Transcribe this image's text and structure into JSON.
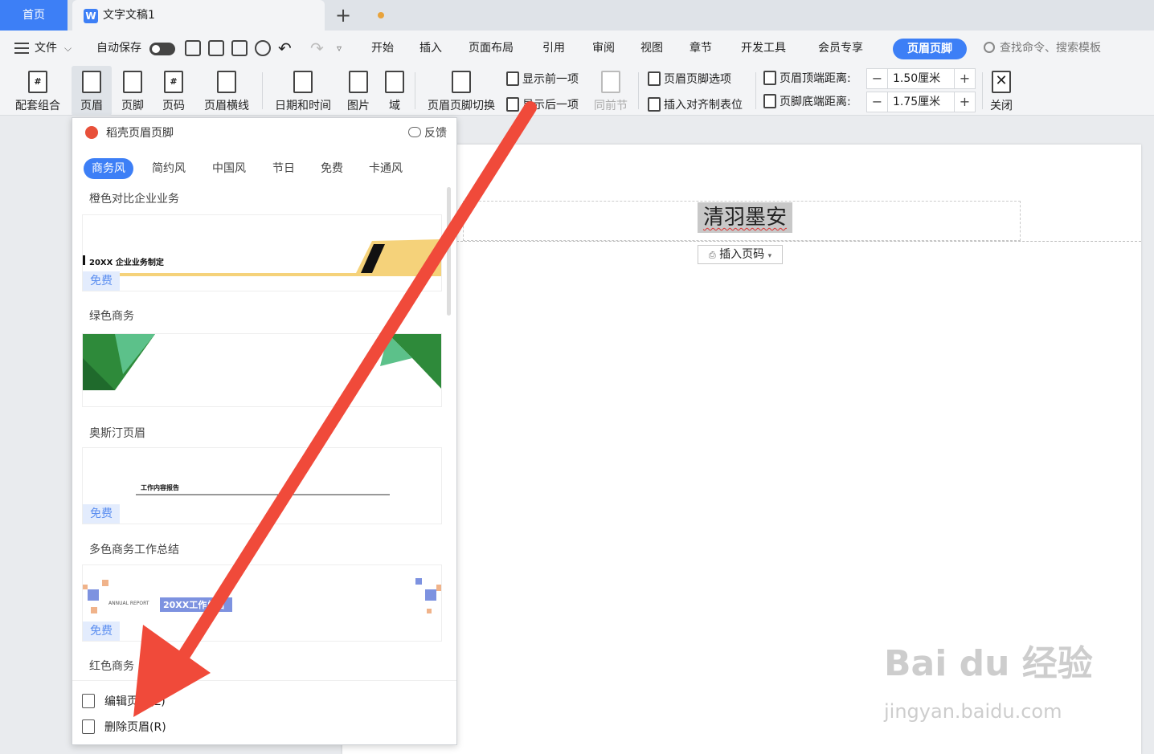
{
  "tabs": {
    "home": "首页",
    "doc_title": "文字文稿1",
    "add": "+"
  },
  "menu": {
    "file": "文件",
    "autosave": "自动保存",
    "items": [
      "开始",
      "插入",
      "页面布局",
      "引用",
      "审阅",
      "视图",
      "章节",
      "开发工具",
      "会员专享"
    ],
    "active": "页眉页脚",
    "search_placeholder": "查找命令、搜索模板"
  },
  "ribbon": {
    "combo": "配套组合",
    "header": "页眉",
    "footer": "页脚",
    "page_number": "页码",
    "header_line": "页眉横线",
    "datetime": "日期和时间",
    "picture": "图片",
    "field": "域",
    "switch": "页眉页脚切换",
    "show_prev": "显示前一项",
    "show_next": "显示后一项",
    "same_as_prev": "同前节",
    "options": "页眉页脚选项",
    "insert_tab": "插入对齐制表位",
    "top_dist_label": "页眉顶端距离:",
    "top_dist_value": "1.50厘米",
    "bottom_dist_label": "页脚底端距离:",
    "bottom_dist_value": "1.75厘米",
    "close": "关闭",
    "minus": "−",
    "plus": "+",
    "icon_page_glyph": "#"
  },
  "panel": {
    "title": "稻壳页眉页脚",
    "feedback": "反馈",
    "categories": [
      "商务风",
      "简约风",
      "中国风",
      "节日",
      "免费",
      "卡通风"
    ],
    "templates": [
      {
        "name": "橙色对比企业业务",
        "preview_text": "20XX 企业业务制定",
        "badge": "免费"
      },
      {
        "name": "绿色商务"
      },
      {
        "name": "奥斯汀页眉",
        "preview_text": "工作内容报告",
        "badge": "免费"
      },
      {
        "name": "多色商务工作总结",
        "preview_text_small": "ANNUAL REPORT",
        "preview_text": "20XX工作总结",
        "badge": "免费"
      },
      {
        "name": "红色商务"
      }
    ],
    "footer_items": [
      {
        "label": "编辑页眉(E)"
      },
      {
        "label": "删除页眉(R)"
      }
    ]
  },
  "document": {
    "header_text": "清羽墨安",
    "insert_page_number": "插入页码"
  },
  "watermark": {
    "main": "Bai du 经验",
    "sub": "jingyan.baidu.com"
  },
  "colors": {
    "accent": "#3d7ff6",
    "arrow": "#f04a3a",
    "free_badge_bg": "#e3ecfd"
  }
}
